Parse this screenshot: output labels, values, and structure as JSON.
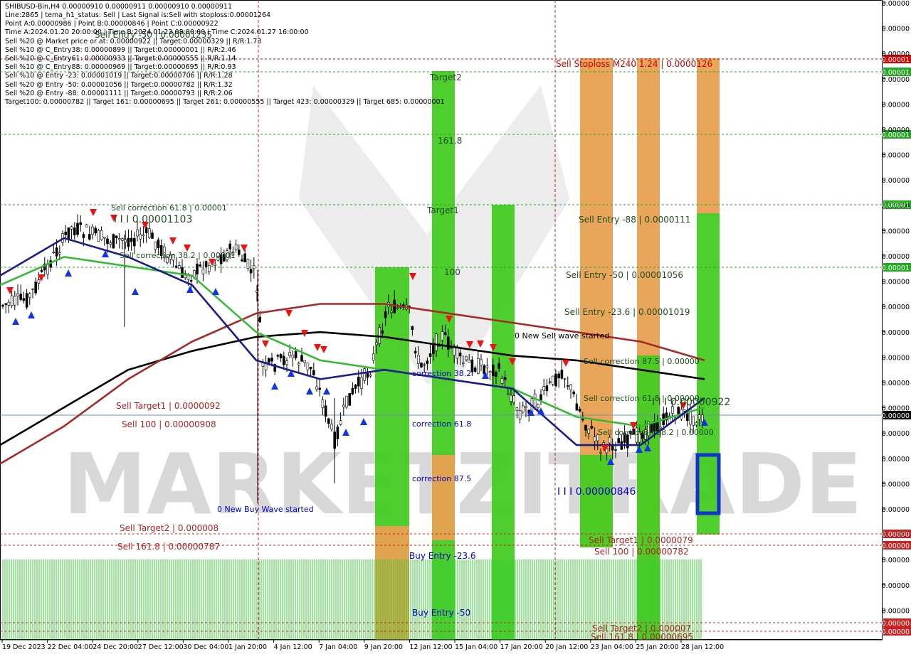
{
  "header": {
    "symbol_line": "SHIBUSD-Bin,H4  0.00000910 0.00000911 0.00000910 0.00000911",
    "info_lines": [
      "Line:2865 | tema_h1_status: Sell | Last Signal is:Sell with stoploss:0.00001264",
      "Point A:0.00000986 | Point B:0.00000846 | Point C:0.00000922",
      "Time A:2024.01.20 20:00:00 | Time B:2024.01.23 08:00:00 | Time C:2024.01.27 16:00:00",
      "Sell %20 @ Market price or at: 0.00000922 || Target:0.00000329 || R/R:1.73",
      "Sell %10 @ C_Entry38: 0.00000899 || Target:0.00000001 || R/R:2.46",
      "Sell %10 @ C_Entry61: 0.00000933 || Target:0.00000555 || R/R:1.14",
      "Sell %10 @ C_Entry88: 0.00000969 || Target:0.00000695 || R/R:0.93",
      "Sell %10 @ Entry -23: 0.00001019 || Target:0.00000706 || R/R:1.28",
      "Sell %20 @ Entry -50: 0.00001056 || Target:0.00000782 || R/R:1.32",
      "Sell %20 @ Entry -88: 0.00001111 || Target:0.00000793 || R/R:2.06",
      "Target100: 0.00000782 || Target 161: 0.00000695 || Target 261: 0.00000555 || Target 423: 0.00000329 || Target 685: 0.00000001"
    ]
  },
  "watermark": "MARKETZITRADE",
  "x_axis": {
    "labels": [
      "19 Dec 2023",
      "22 Dec 04:00",
      "24 Dec 20:00",
      "27 Dec 12:00",
      "30 Dec 04:00",
      "1 Jan 20:00",
      "4 Jan 12:00",
      "7 Jan 04:00",
      "9 Jan 20:00",
      "12 Jan 12:00",
      "15 Jan 04:00",
      "17 Jan 20:00",
      "20 Jan 12:00",
      "23 Jan 04:00",
      "25 Jan 20:00",
      "28 Jan 12:00"
    ]
  },
  "y_axis": {
    "tick_label": "0.00000",
    "price_tags": [
      {
        "text": "0.00001",
        "color": "#dd0000"
      },
      {
        "text": "0.00001",
        "color": "#22aa22"
      },
      {
        "text": "0.00001",
        "color": "#22aa22"
      },
      {
        "text": "0.00001",
        "color": "#22aa22"
      },
      {
        "text": "0.00001",
        "color": "#22aa22"
      },
      {
        "text": "0.00000",
        "color": "#000000"
      },
      {
        "text": "0.00000",
        "color": "#cc2222"
      },
      {
        "text": "0.00000",
        "color": "#cc2222"
      },
      {
        "text": "0.00000",
        "color": "#cc2222"
      },
      {
        "text": "0.00000",
        "color": "#cc2222"
      }
    ]
  },
  "annotations": [
    {
      "text": "Sell Stoploss M240 1.24 | 0.0000126",
      "color": "#cc0000"
    },
    {
      "text": "Sell Entry -88 | 0.0000111",
      "color": "#1f4e1f"
    },
    {
      "text": "Sell Entry -50 | 0.00001056",
      "color": "#1f4e1f"
    },
    {
      "text": "Sell Entry -23.6 | 0.00001019",
      "color": "#1f4e1f"
    },
    {
      "text": "Sell correction 87.5 | 0.00000",
      "color": "#1f4e1f"
    },
    {
      "text": "Sell correction 61.8 | 0.00000",
      "color": "#1f4e1f"
    },
    {
      "text": "Sell correction 38.2 | 0.00000",
      "color": "#1f4e1f"
    },
    {
      "text": "I I I 0.00000922",
      "color": "#1f4e1f"
    },
    {
      "text": "I I I 0.00000846",
      "color": "#0000cc"
    },
    {
      "text": "Sell Target1 | 0.0000079",
      "color": "#b22222"
    },
    {
      "text": "Sell 100 | 0.00000782",
      "color": "#b22222"
    },
    {
      "text": "Sell Target2 | 0.000007",
      "color": "#b22222"
    },
    {
      "text": "Sell 161.8 | 0.00000695",
      "color": "#b22222"
    },
    {
      "text": "Sell Target1 | 0.0000092",
      "color": "#b22222"
    },
    {
      "text": "Sell 100 | 0.00000908",
      "color": "#b22222"
    },
    {
      "text": "Sell Target2 | 0.000008",
      "color": "#b22222"
    },
    {
      "text": "Sell 161.8 | 0.00000787",
      "color": "#b22222"
    },
    {
      "text": "0 New Buy Wave started",
      "color": "#0000cc"
    },
    {
      "text": "0 New Sell wave started",
      "color": "#000000"
    },
    {
      "text": "Sell correction 61.8 | 0.00001",
      "color": "#1f4e1f"
    },
    {
      "text": "I I I 0.00001103",
      "color": "#1f4e1f"
    },
    {
      "text": "Sell correction 38.2 | 0.00001",
      "color": "#1f4e1f"
    },
    {
      "text": "Sell Entry -50 | 0.00001235",
      "color": "#1f4e1f"
    },
    {
      "text": "Target2",
      "color": "#1f4e1f"
    },
    {
      "text": "161.8",
      "color": "#1f4e1f"
    },
    {
      "text": "Target1",
      "color": "#1f4e1f"
    },
    {
      "text": "100",
      "color": "#1f4e1f"
    },
    {
      "text": "correction 38.2",
      "color": "#0000cc"
    },
    {
      "text": "correction 61.8",
      "color": "#0000cc"
    },
    {
      "text": "correction 87.5",
      "color": "#0000cc"
    },
    {
      "text": "Buy Entry -23.6",
      "color": "#0000cc"
    },
    {
      "text": "Buy Entry -50",
      "color": "#0000cc"
    }
  ],
  "chart_data": {
    "type": "candlestick",
    "symbol": "SHIBUSD-Bin",
    "timeframe": "H4",
    "series": [
      {
        "name": "ma_black",
        "color": "#000000",
        "values": [
          8.7e-06,
          9.1e-06,
          9.5e-06,
          9.7e-06,
          9.85e-06,
          9.9e-06,
          9.85e-06,
          9.75e-06,
          9.65e-06,
          9.6e-06,
          9.5e-06,
          9.4e-06
        ]
      },
      {
        "name": "ma_brown",
        "color": "#a52a2a",
        "values": [
          8.5e-06,
          8.9e-06,
          9.4e-06,
          9.8e-06,
          1.01e-05,
          1.02e-05,
          1.02e-05,
          1.01e-05,
          1e-05,
          9.9e-06,
          9.8e-06,
          9.6e-06
        ]
      },
      {
        "name": "ma_green",
        "color": "#33bb33",
        "values": [
          1.04e-05,
          1.07e-05,
          1.06e-05,
          1.05e-05,
          9.9e-06,
          9.6e-06,
          9.5e-06,
          9.4e-06,
          9.3e-06,
          9e-06,
          8.9e-06,
          9.1e-06
        ]
      },
      {
        "name": "ma_navy",
        "color": "#1c1c8c",
        "values": [
          1.05e-05,
          1.09e-05,
          1.07e-05,
          1.04e-05,
          9.6e-06,
          9.4e-06,
          9.5e-06,
          9.4e-06,
          9.3e-06,
          8.7e-06,
          8.7e-06,
          9.2e-06
        ]
      }
    ],
    "levels": {
      "stoploss": 1.26e-05,
      "entry_m88": 1.11e-05,
      "entry_m50": 1.056e-05,
      "entry_m23_6": 1.019e-05,
      "point_c": 9.22e-06,
      "point_b": 8.46e-06,
      "target1": 7.9e-06,
      "target100": 7.82e-06,
      "target2": 7e-06,
      "target161": 6.95e-06,
      "current": 9.11e-06
    }
  }
}
